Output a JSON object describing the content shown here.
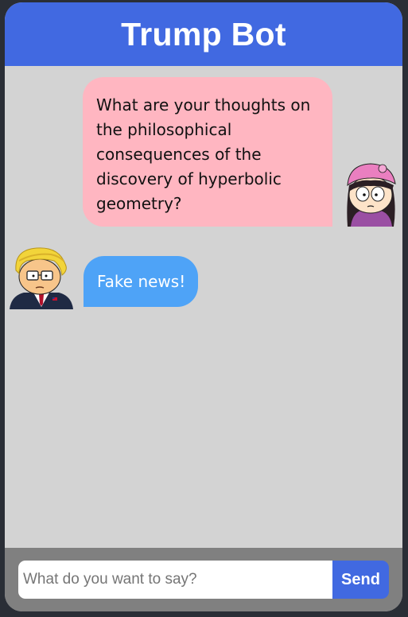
{
  "header": {
    "title": "Trump Bot"
  },
  "messages": [
    {
      "role": "user",
      "text": "What are your thoughts on the philosophical consequences of the discovery of hyperbolic geometry?",
      "avatar": "wendy-avatar"
    },
    {
      "role": "bot",
      "text": "Fake news!",
      "avatar": "trump-avatar"
    }
  ],
  "composer": {
    "placeholder": "What do you want to say?",
    "value": "",
    "send_label": "Send"
  },
  "colors": {
    "header": "#4169e1",
    "chat_background": "#d3d3d3",
    "user_bubble": "#ffb6c1",
    "bot_bubble": "#4ea3f7",
    "footer": "#808080",
    "send_button": "#4169e1"
  }
}
